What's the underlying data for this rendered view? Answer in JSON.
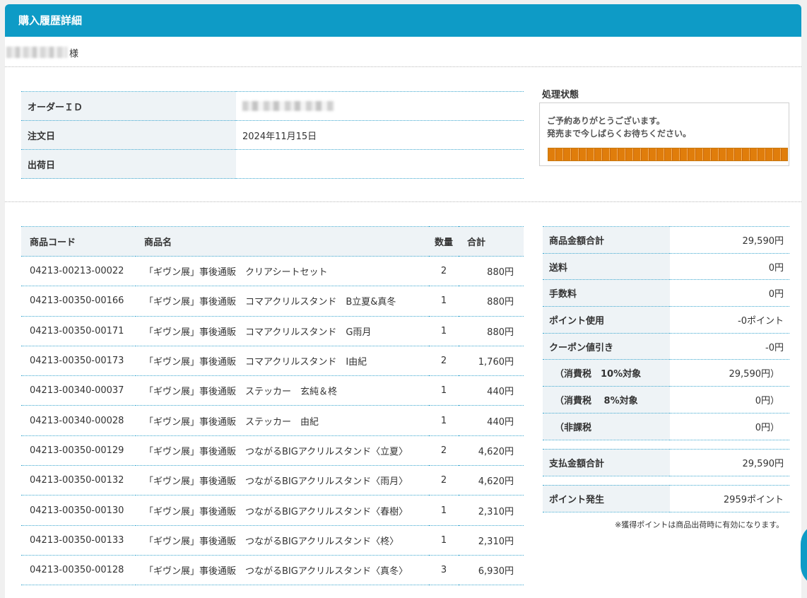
{
  "header": {
    "title": "購入履歴詳細"
  },
  "customer": {
    "suffix": "様"
  },
  "order_info": {
    "rows": [
      {
        "label": "オーダーＩＤ",
        "value": ""
      },
      {
        "label": "注文日",
        "value": "2024年11月15日"
      },
      {
        "label": "出荷日",
        "value": ""
      }
    ]
  },
  "status": {
    "title": "処理状態",
    "line1": "ご予約ありがとうございます。",
    "line2": "発売まで今しばらくお待ちください。",
    "progress_fraction": 1.0,
    "progress_color": "#e98a18"
  },
  "items": {
    "headers": {
      "code": "商品コード",
      "name": "商品名",
      "qty": "数量",
      "total": "合計"
    },
    "rows": [
      {
        "code": "04213-00213-00022",
        "name": "「ギヴン展」事後通販　クリアシートセット",
        "qty": "2",
        "total": "880円"
      },
      {
        "code": "04213-00350-00166",
        "name": "「ギヴン展」事後通販　コマアクリルスタンド　B立夏&真冬",
        "qty": "1",
        "total": "880円"
      },
      {
        "code": "04213-00350-00171",
        "name": "「ギヴン展」事後通販　コマアクリルスタンド　G雨月",
        "qty": "1",
        "total": "880円"
      },
      {
        "code": "04213-00350-00173",
        "name": "「ギヴン展」事後通販　コマアクリルスタンド　I由紀",
        "qty": "2",
        "total": "1,760円"
      },
      {
        "code": "04213-00340-00037",
        "name": "「ギヴン展」事後通販　ステッカー　玄純＆柊",
        "qty": "1",
        "total": "440円"
      },
      {
        "code": "04213-00340-00028",
        "name": "「ギヴン展」事後通販　ステッカー　由紀",
        "qty": "1",
        "total": "440円"
      },
      {
        "code": "04213-00350-00129",
        "name": "「ギヴン展」事後通販　つながるBIGアクリルスタンド〈立夏〉",
        "qty": "2",
        "total": "4,620円"
      },
      {
        "code": "04213-00350-00132",
        "name": "「ギヴン展」事後通販　つながるBIGアクリルスタンド〈雨月〉",
        "qty": "2",
        "total": "4,620円"
      },
      {
        "code": "04213-00350-00130",
        "name": "「ギヴン展」事後通販　つながるBIGアクリルスタンド〈春樹〉",
        "qty": "1",
        "total": "2,310円"
      },
      {
        "code": "04213-00350-00133",
        "name": "「ギヴン展」事後通販　つながるBIGアクリルスタンド〈柊〉",
        "qty": "1",
        "total": "2,310円"
      },
      {
        "code": "04213-00350-00128",
        "name": "「ギヴン展」事後通販　つながるBIGアクリルスタンド〈真冬〉",
        "qty": "3",
        "total": "6,930円"
      }
    ]
  },
  "summary": {
    "subtotal_label": "商品金額合計",
    "subtotal": "29,590円",
    "shipping_label": "送料",
    "shipping": "0円",
    "fee_label": "手数料",
    "fee": "0円",
    "points_used_label": "ポイント使用",
    "points_used": "-0ポイント",
    "coupon_label": "クーポン値引き",
    "coupon": "-0円",
    "tax10_label": "（消費税　10%対象",
    "tax10": "29,590円）",
    "tax8_label": "（消費税　 8%対象",
    "tax8": "0円）",
    "nontax_label": "（非課税",
    "nontax": "0円）",
    "payment_label": "支払金額合計",
    "payment": "29,590円",
    "points_earned_label": "ポイント発生",
    "points_earned": "2959ポイント",
    "note": "※獲得ポイントは商品出荷時に有効になります。"
  }
}
